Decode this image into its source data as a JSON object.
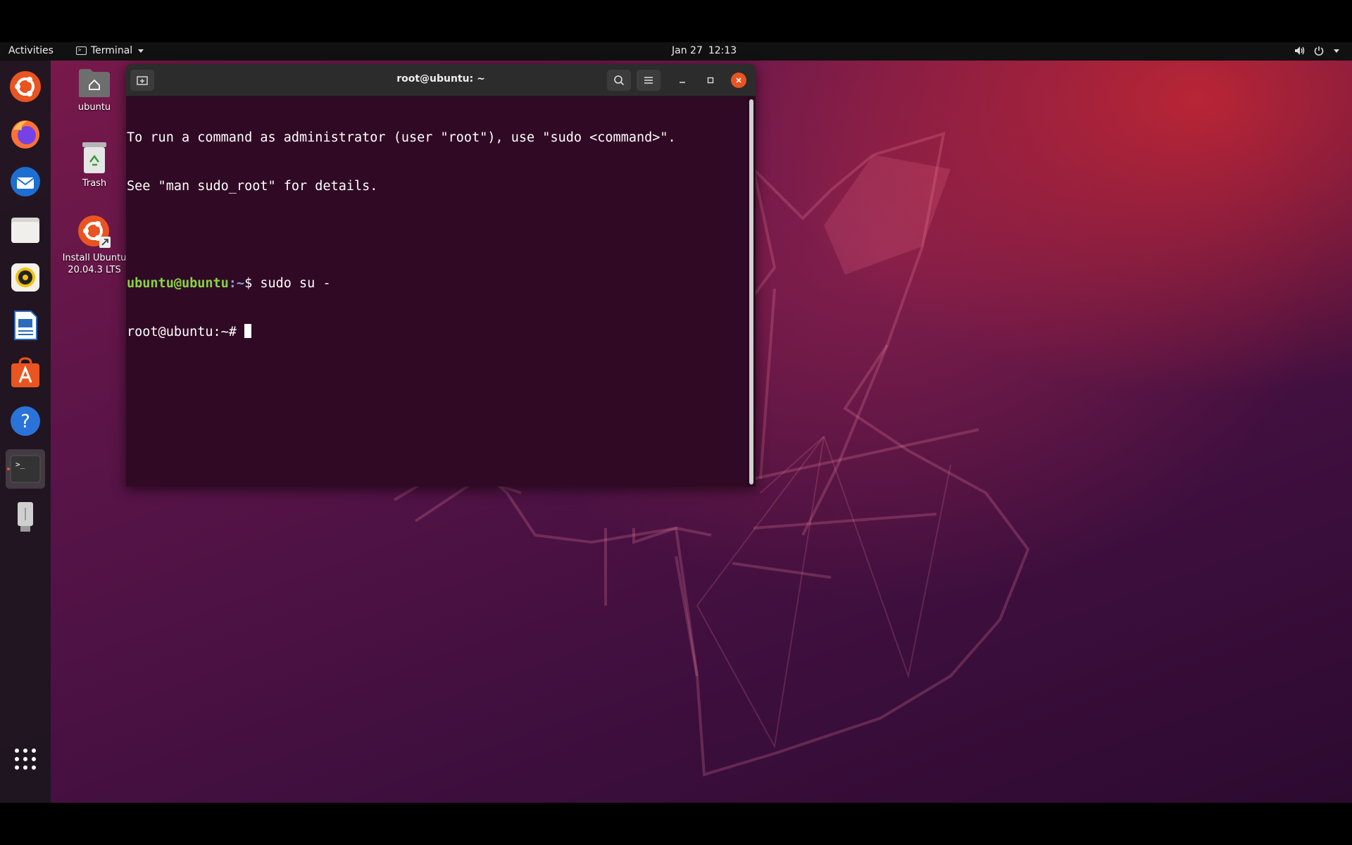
{
  "top_panel": {
    "activities": "Activities",
    "app_menu": "Terminal",
    "clock_date": "Jan 27",
    "clock_time": "12:13"
  },
  "dock": {
    "items": [
      {
        "name": "ubuntu-installer"
      },
      {
        "name": "firefox"
      },
      {
        "name": "thunderbird"
      },
      {
        "name": "files"
      },
      {
        "name": "rhythmbox"
      },
      {
        "name": "libreoffice-writer"
      },
      {
        "name": "ubuntu-software"
      },
      {
        "name": "help"
      },
      {
        "name": "terminal",
        "active": true
      },
      {
        "name": "usb-drive"
      }
    ],
    "show_apps": "show-applications"
  },
  "desktop_icons": [
    {
      "label": "ubuntu"
    },
    {
      "label": "Trash"
    },
    {
      "label_line1": "Install Ubuntu",
      "label_line2": "20.04.3 LTS"
    }
  ],
  "terminal": {
    "title": "root@ubuntu: ~",
    "lines": [
      "To run a command as administrator (user \"root\"), use \"sudo <command>\".",
      "See \"man sudo_root\" for details."
    ],
    "prompt1_user": "ubuntu@ubuntu",
    "prompt1_path": ":~",
    "prompt1_sym": "$ ",
    "prompt1_cmd": "sudo su -",
    "prompt2": "root@ubuntu:~# "
  },
  "colors": {
    "accent": "#e95420",
    "terminal_bg": "#300a24",
    "prompt_user": "#87d441",
    "prompt_path": "#8aa6cf"
  }
}
